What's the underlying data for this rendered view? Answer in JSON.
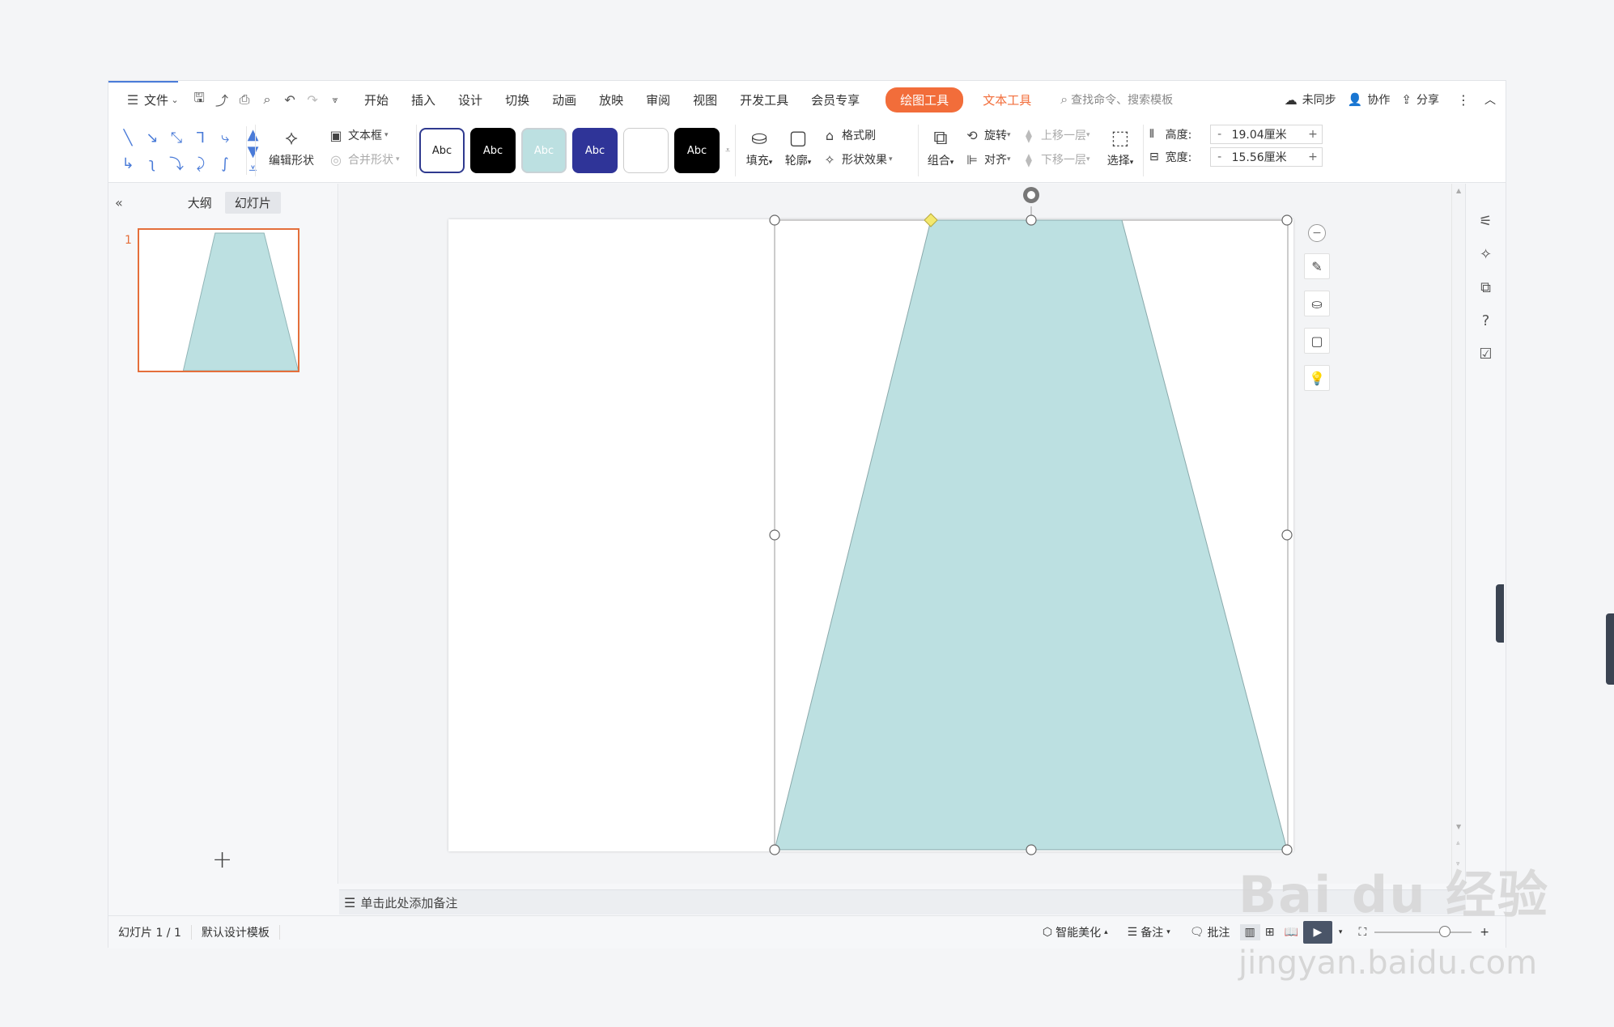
{
  "menubar": {
    "file_label": "文件",
    "tabs": [
      "开始",
      "插入",
      "设计",
      "切换",
      "动画",
      "放映",
      "审阅",
      "视图",
      "开发工具",
      "会员专享"
    ],
    "drawing_tools": "绘图工具",
    "text_tools": "文本工具",
    "search_placeholder": "查找命令、搜索模板",
    "not_synced": "未同步",
    "collaborate": "协作",
    "share": "分享"
  },
  "ribbon": {
    "edit_shape": "编辑形状",
    "text_box": "文本框",
    "merge_shape": "合并形状",
    "style_sample": "Abc",
    "fill": "填充",
    "outline": "轮廓",
    "format_painter": "格式刷",
    "shape_effect": "形状效果",
    "group": "组合",
    "rotate": "旋转",
    "align": "对齐",
    "bring_forward": "上移一层",
    "send_backward": "下移一层",
    "select": "选择",
    "height_label": "高度:",
    "height_value": "19.04厘米",
    "width_label": "宽度:",
    "width_value": "15.56厘米",
    "minus": "-",
    "plus": "+"
  },
  "left_panel": {
    "outline_tab": "大纲",
    "slides_tab": "幻灯片",
    "slide_number": "1",
    "add": "+"
  },
  "notes": {
    "placeholder": "单击此处添加备注"
  },
  "status": {
    "slide_count": "幻灯片 1 / 1",
    "template": "默认设计模板",
    "smart_beautify": "智能美化",
    "notes": "备注",
    "comments": "批注"
  },
  "watermark": {
    "brand": "Bai du 经验",
    "url": "jingyan.baidu.com"
  },
  "colors": {
    "shape_fill": "#bce0e1",
    "accent_orange": "#f26d3a",
    "selection_border": "#e46f3b"
  },
  "icons": {
    "menu": "menu-icon",
    "save": "save-icon",
    "print": "print-icon",
    "undo": "undo-icon",
    "redo": "redo-icon",
    "search": "search-icon",
    "play": "play-icon"
  }
}
